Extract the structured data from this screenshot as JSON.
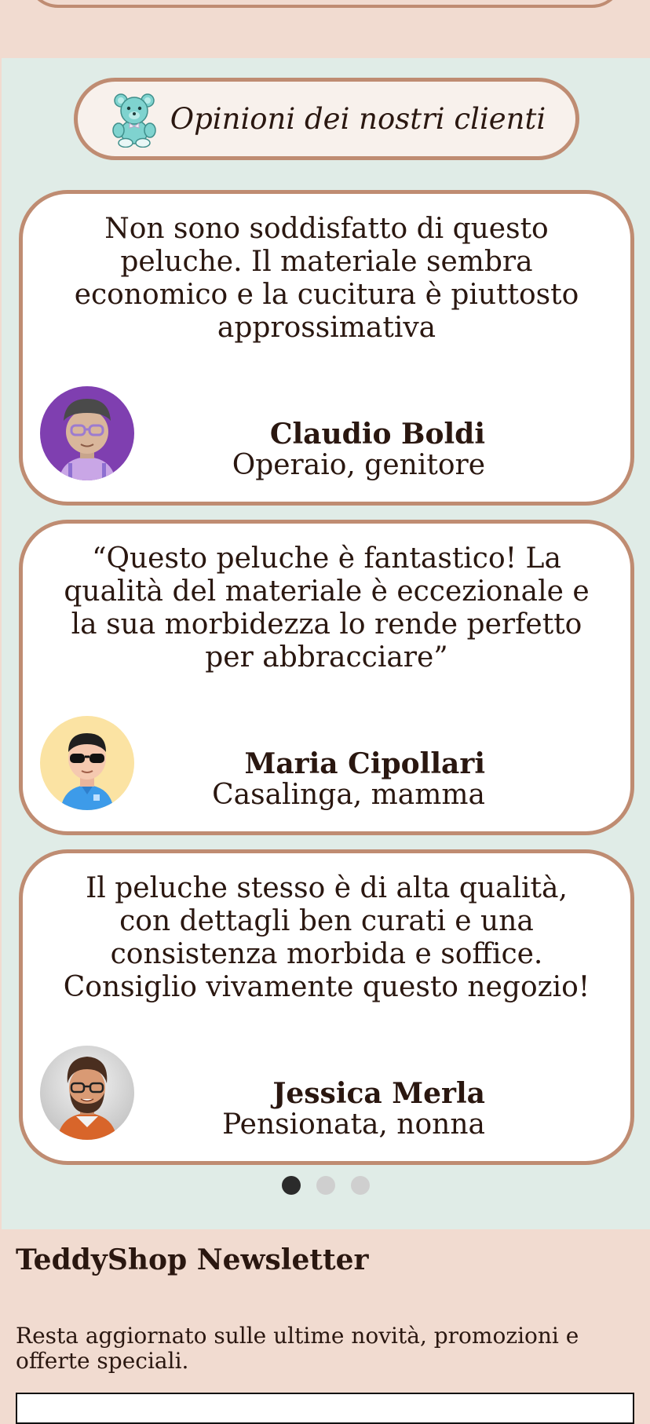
{
  "testimonials": {
    "title": "Opinioni dei nostri clienti",
    "title_icon": "teddy-bear-icon",
    "reviews": [
      {
        "text": "Non sono soddisfatto di questo peluche. Il materiale sembra economico e la cucitura è piuttosto approssimativa",
        "name": "Claudio Boldi",
        "role": "Operaio, genitore"
      },
      {
        "text": "“Questo peluche è fantastico! La qualità del materiale è eccezionale e la sua morbidezza lo rende perfetto per abbracciare”",
        "name": "Maria Cipollari",
        "role": "Casalinga, mamma"
      },
      {
        "text": "Il peluche stesso è di alta qualità, con dettagli ben curati e una consistenza morbida e soffice. Consiglio vivamente questo negozio!",
        "name": "Jessica Merla",
        "role": "Pensionata, nonna"
      }
    ],
    "pagination": {
      "count": 3,
      "active": 1
    }
  },
  "newsletter": {
    "title": "TeddyShop Newsletter",
    "description": "Resta aggiornato sulle ultime novità, promozioni e offerte speciali.",
    "email_placeholder": ""
  },
  "colors": {
    "page_background": "#f1dbd0",
    "section_background": "#e0ece7",
    "card_border": "#bf8c72",
    "text": "#2a1710",
    "dot_active": "#2b2b2b",
    "dot_inactive": "#cfcfcf"
  }
}
